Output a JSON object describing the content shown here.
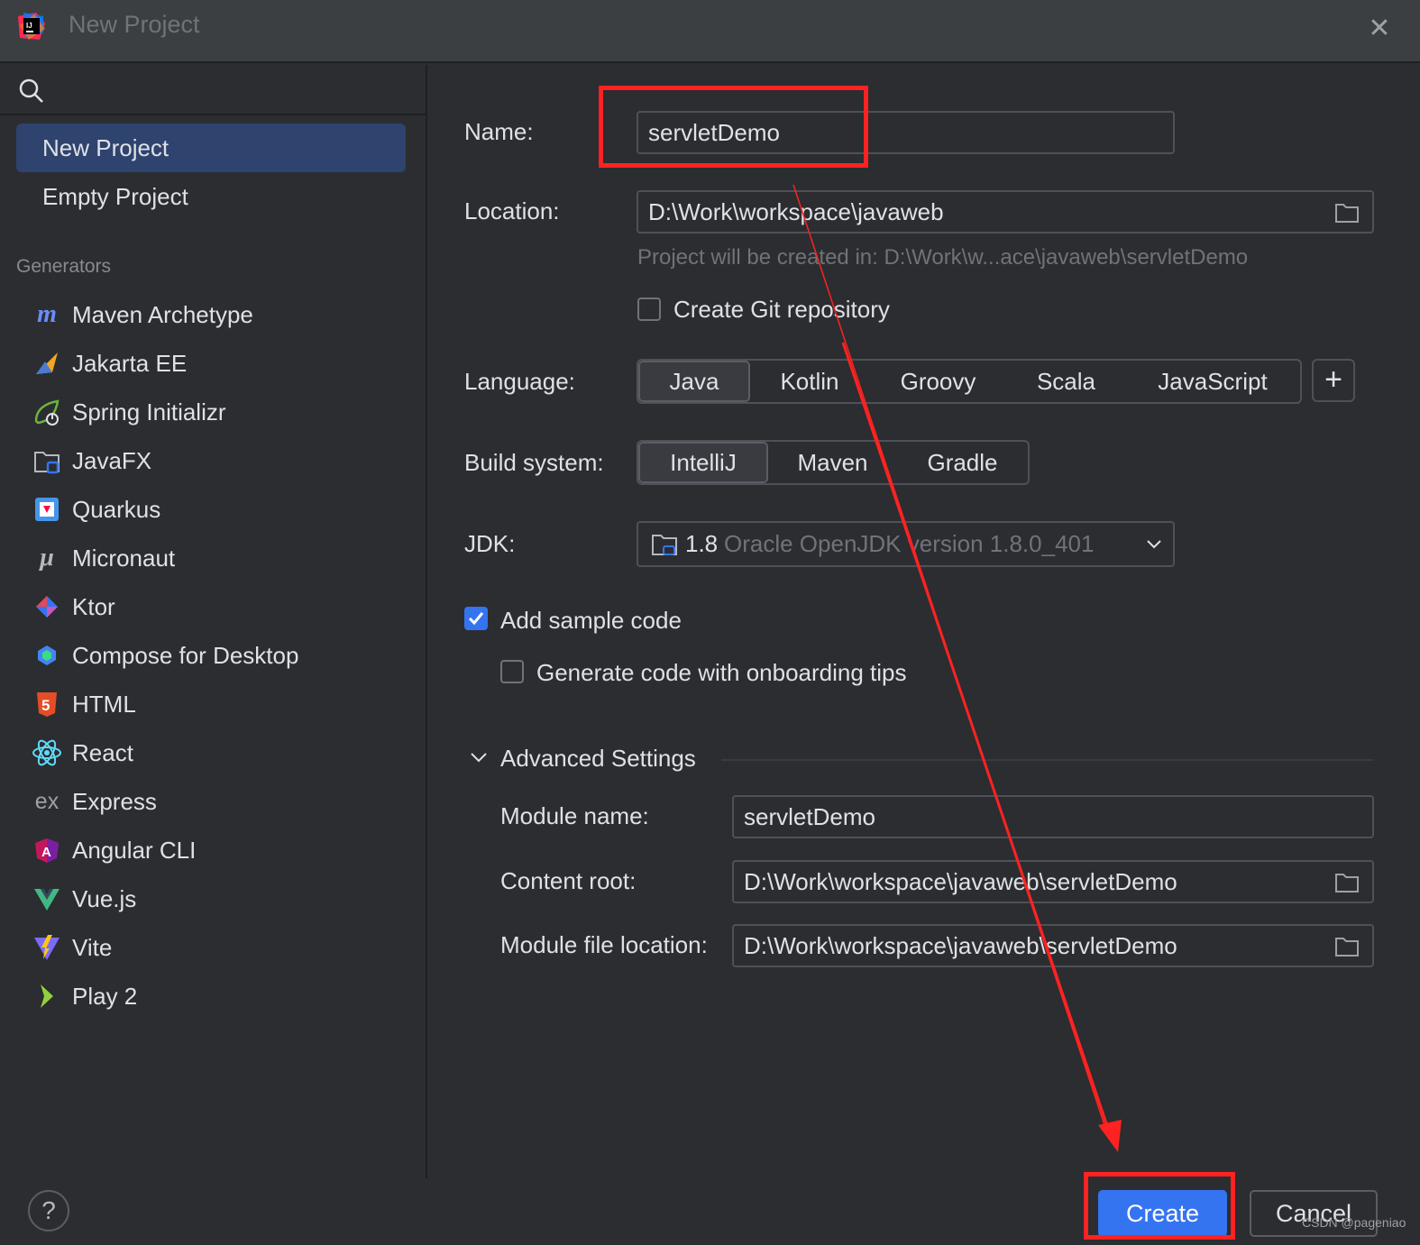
{
  "window": {
    "title": "New Project",
    "close_icon": "close-icon"
  },
  "sidebar": {
    "items": [
      {
        "label": "New Project",
        "selected": true
      },
      {
        "label": "Empty Project",
        "selected": false
      }
    ],
    "generators_label": "Generators",
    "generators": [
      {
        "label": "Maven Archetype",
        "icon": "maven-icon"
      },
      {
        "label": "Jakarta EE",
        "icon": "jakarta-icon"
      },
      {
        "label": "Spring Initializr",
        "icon": "spring-icon"
      },
      {
        "label": "JavaFX",
        "icon": "javafx-icon"
      },
      {
        "label": "Quarkus",
        "icon": "quarkus-icon"
      },
      {
        "label": "Micronaut",
        "icon": "micronaut-icon"
      },
      {
        "label": "Ktor",
        "icon": "ktor-icon"
      },
      {
        "label": "Compose for Desktop",
        "icon": "compose-icon"
      },
      {
        "label": "HTML",
        "icon": "html-icon"
      },
      {
        "label": "React",
        "icon": "react-icon"
      },
      {
        "label": "Express",
        "icon": "express-icon"
      },
      {
        "label": "Angular CLI",
        "icon": "angular-icon"
      },
      {
        "label": "Vue.js",
        "icon": "vue-icon"
      },
      {
        "label": "Vite",
        "icon": "vite-icon"
      },
      {
        "label": "Play 2",
        "icon": "play-icon"
      }
    ],
    "help": "?"
  },
  "form": {
    "name_label": "Name:",
    "name_value": "servletDemo",
    "location_label": "Location:",
    "location_value": "D:\\Work\\workspace\\javaweb",
    "location_hint": "Project will be created in: D:\\Work\\w...ace\\javaweb\\servletDemo",
    "git_label": "Create Git repository",
    "git_checked": false,
    "language_label": "Language:",
    "languages": [
      "Java",
      "Kotlin",
      "Groovy",
      "Scala",
      "JavaScript"
    ],
    "language_selected": "Java",
    "build_label": "Build system:",
    "build_systems": [
      "IntelliJ",
      "Maven",
      "Gradle"
    ],
    "build_selected": "IntelliJ",
    "jdk_label": "JDK:",
    "jdk_version": "1.8",
    "jdk_desc": "Oracle OpenJDK version 1.8.0_401",
    "sample_label": "Add sample code",
    "sample_checked": true,
    "onboarding_label": "Generate code with onboarding tips",
    "onboarding_checked": false,
    "advanced_label": "Advanced Settings",
    "module_name_label": "Module name:",
    "module_name_value": "servletDemo",
    "content_root_label": "Content root:",
    "content_root_value": "D:\\Work\\workspace\\javaweb\\servletDemo",
    "module_file_label": "Module file location:",
    "module_file_value": "D:\\Work\\workspace\\javaweb\\servletDemo"
  },
  "buttons": {
    "create": "Create",
    "cancel": "Cancel"
  },
  "watermark": "CSDN @pageniao",
  "colors": {
    "accent": "#3574f0",
    "annotation": "#ff2222",
    "background": "#2b2d30"
  }
}
